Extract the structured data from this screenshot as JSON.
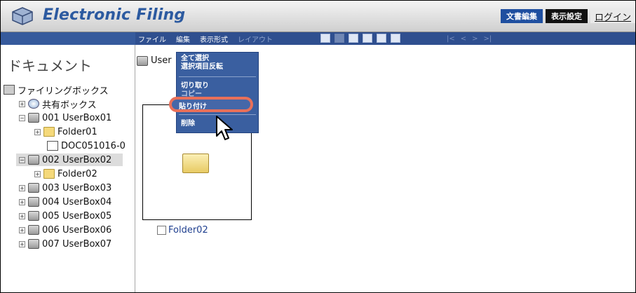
{
  "header": {
    "title": "Electronic Filing",
    "btn_edit": "文書編集",
    "btn_display": "表示設定",
    "btn_login": "ログイン"
  },
  "menubar": {
    "file": "ファイル",
    "edit": "編集",
    "view": "表示形式",
    "layout": "レイアウト"
  },
  "pager": {
    "first": "|<",
    "prev": "<",
    "next": ">",
    "last": ">|"
  },
  "left_pane": {
    "title": "ドキュメント",
    "tree": [
      {
        "label": "ファイリングボックス"
      },
      {
        "label": "共有ボックス"
      },
      {
        "label": "001 UserBox01"
      },
      {
        "label": "Folder01"
      },
      {
        "label": "DOC051016-0"
      },
      {
        "label": "002 UserBox02"
      },
      {
        "label": "Folder02"
      },
      {
        "label": "003 UserBox03"
      },
      {
        "label": "004 UserBox04"
      },
      {
        "label": "005 UserBox05"
      },
      {
        "label": "006 UserBox06"
      },
      {
        "label": "007 UserBox07"
      }
    ]
  },
  "right_pane": {
    "path_label": "User",
    "item_label": "Folder02"
  },
  "edit_menu": {
    "select_all": "全て選択",
    "invert": "選択項目反転",
    "cut": "切り取り",
    "copy": "コピー",
    "paste": "貼り付け",
    "delete": "削除"
  }
}
